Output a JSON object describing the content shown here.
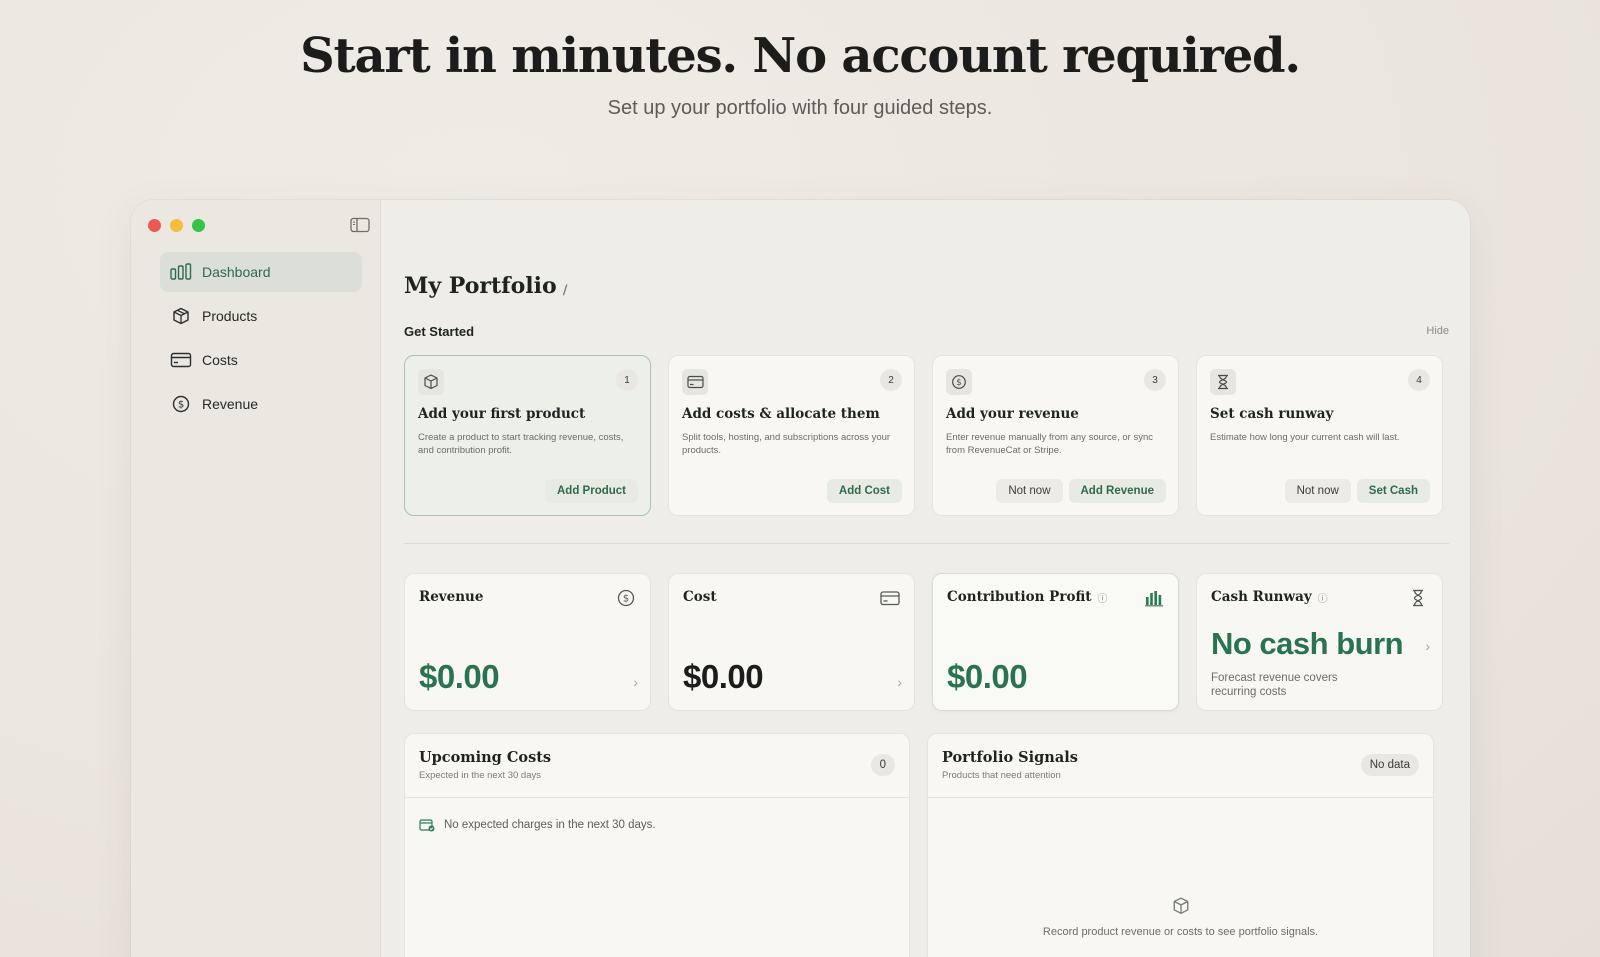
{
  "hero": {
    "title": "Start in minutes. No account required.",
    "subtitle": "Set up your portfolio with four guided steps."
  },
  "sidebar": {
    "items": [
      {
        "label": "Dashboard",
        "icon": "bar-chart-icon",
        "active": true
      },
      {
        "label": "Products",
        "icon": "box-icon"
      },
      {
        "label": "Costs",
        "icon": "credit-card-icon"
      },
      {
        "label": "Revenue",
        "icon": "dollar-circle-icon"
      }
    ]
  },
  "main": {
    "title": "My Portfolio",
    "get_started": "Get Started",
    "hide": "Hide",
    "steps": [
      {
        "num": "1",
        "icon": "box-icon",
        "title": "Add your first product",
        "desc": "Create a product to start tracking revenue, costs, and contribution profit.",
        "secondary": "",
        "primary": "Add Product"
      },
      {
        "num": "2",
        "icon": "credit-card-icon",
        "title": "Add costs & allocate them",
        "desc": "Split tools, hosting, and subscriptions across your products.",
        "secondary": "",
        "primary": "Add Cost"
      },
      {
        "num": "3",
        "icon": "dollar-circle-icon",
        "title": "Add your revenue",
        "desc": "Enter revenue manually from any source, or sync from RevenueCat or Stripe.",
        "secondary": "Not now",
        "primary": "Add Revenue"
      },
      {
        "num": "4",
        "icon": "hourglass-icon",
        "title": "Set cash runway",
        "desc": "Estimate how long your current cash will last.",
        "secondary": "Not now",
        "primary": "Set Cash"
      }
    ],
    "stats": [
      {
        "label": "Revenue",
        "value": "$0.00"
      },
      {
        "label": "Cost",
        "value": "$0.00"
      },
      {
        "label": "Contribution Profit",
        "value": "$0.00"
      },
      {
        "label": "Cash Runway",
        "value": "No cash burn",
        "note": "Forecast revenue covers recurring costs"
      }
    ],
    "upcoming": {
      "title": "Upcoming Costs",
      "subtitle": "Expected in the next 30 days",
      "badge": "0",
      "empty": "No expected charges in the next 30 days."
    },
    "signals": {
      "title": "Portfolio Signals",
      "subtitle": "Products that need attention",
      "badge": "No data",
      "empty": "Record product revenue or costs to see portfolio signals."
    }
  },
  "colors": {
    "accent": "#2d6b4a",
    "value_green": "#2a7350",
    "close": "#ee5a52",
    "minimize": "#f4bd3a",
    "maximize": "#37c248"
  }
}
